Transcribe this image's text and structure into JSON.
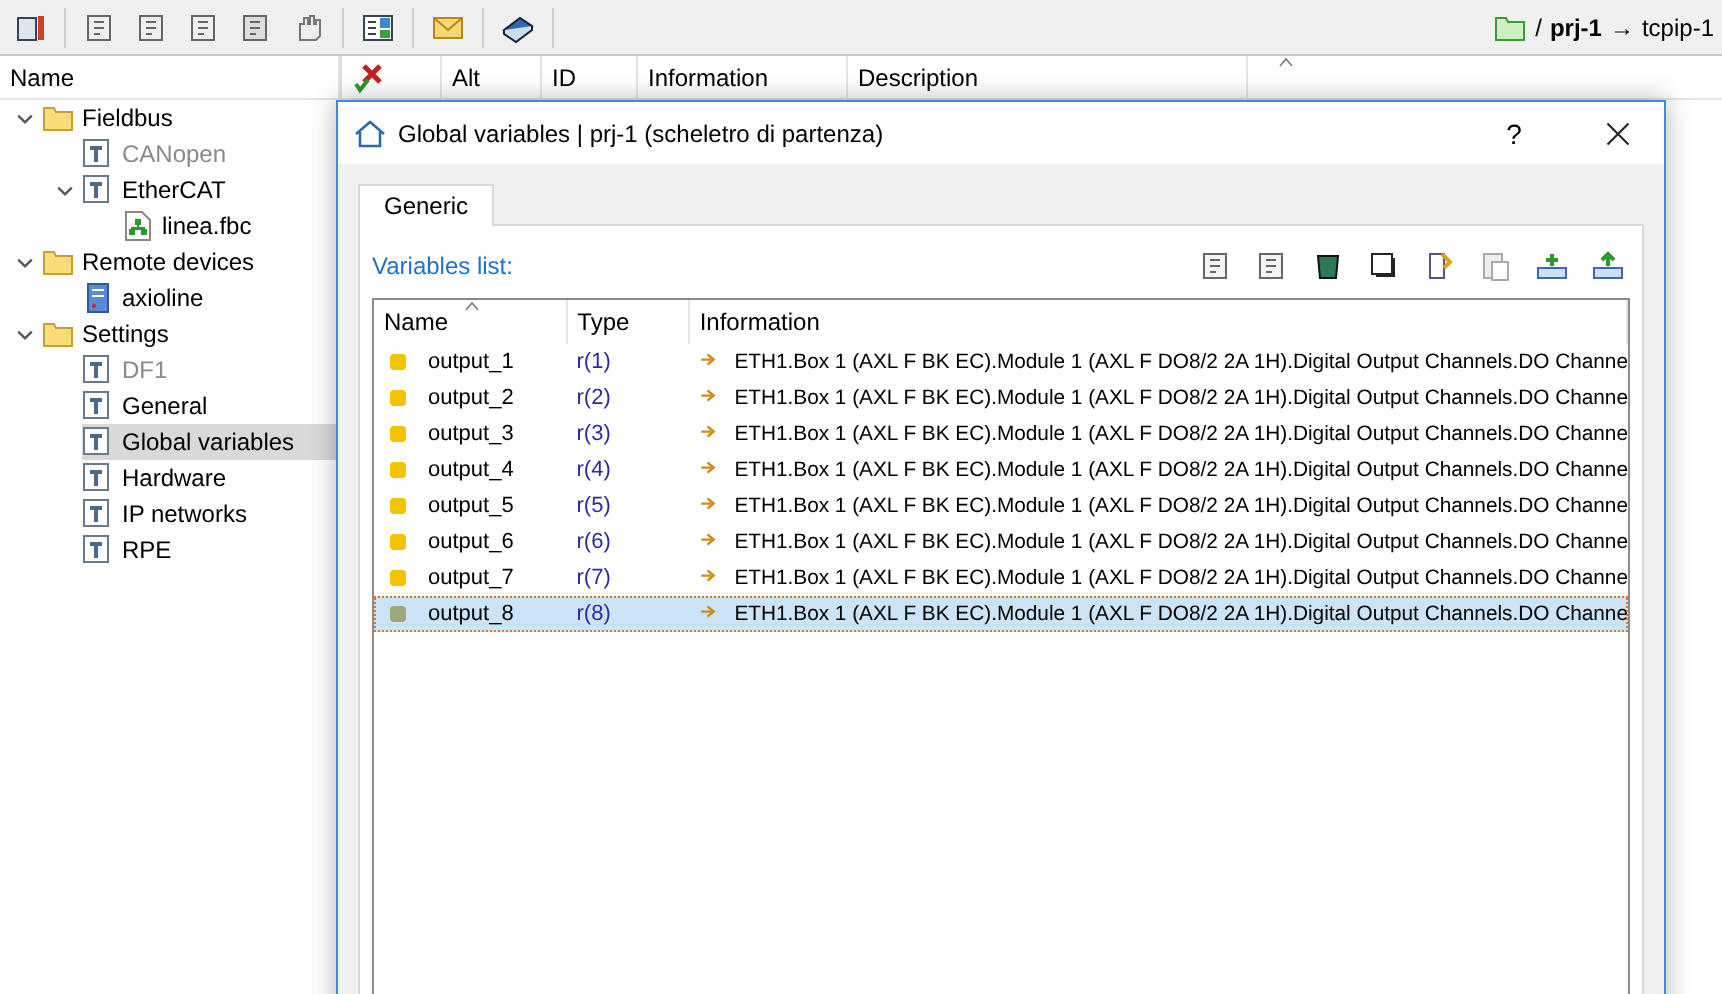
{
  "toolbar": {
    "breadcrumb": {
      "separator": "/",
      "project": "prj-1",
      "arrow": "→",
      "target": "tcpip-1"
    }
  },
  "tree": {
    "header": "Name",
    "items": [
      {
        "label": "Fieldbus",
        "kind": "folder",
        "expanded": true,
        "selected": false,
        "children": [
          {
            "label": "CANopen",
            "kind": "config",
            "disabled": true,
            "selected": false
          },
          {
            "label": "EtherCAT",
            "kind": "config",
            "disabled": false,
            "expanded": true,
            "selected": false,
            "children": [
              {
                "label": "linea.fbc",
                "kind": "network",
                "selected": false
              }
            ]
          }
        ]
      },
      {
        "label": "Remote devices",
        "kind": "folder",
        "expanded": true,
        "selected": false,
        "children": [
          {
            "label": "axioline",
            "kind": "device",
            "selected": false
          }
        ]
      },
      {
        "label": "Settings",
        "kind": "folder",
        "expanded": true,
        "selected": false,
        "children": [
          {
            "label": "DF1",
            "kind": "config",
            "disabled": true,
            "selected": false
          },
          {
            "label": "General",
            "kind": "config",
            "disabled": false,
            "selected": false
          },
          {
            "label": "Global variables",
            "kind": "config",
            "disabled": false,
            "selected": true
          },
          {
            "label": "Hardware",
            "kind": "config",
            "disabled": false,
            "selected": false
          },
          {
            "label": "IP networks",
            "kind": "config",
            "disabled": false,
            "selected": false
          },
          {
            "label": "RPE",
            "kind": "config",
            "disabled": false,
            "selected": false
          }
        ]
      }
    ]
  },
  "list_view": {
    "columns": [
      "Alt",
      "ID",
      "Information",
      "Description"
    ]
  },
  "dialog": {
    "title": "Global variables | prj-1 (scheletro di partenza)",
    "help": "?",
    "tabs": [
      {
        "label": "Generic",
        "selected": true
      }
    ],
    "section_label": "Variables list:",
    "table": {
      "columns": [
        "Name",
        "Type",
        "Information"
      ],
      "rows": [
        {
          "name": "output_1",
          "type": "r(1)",
          "information": "ETH1.Box 1 (AXL F BK EC).Module 1 (AXL F DO8/2 2A 1H).Digital Output Channels.DO Channe",
          "color": "#f5c400",
          "selected": false
        },
        {
          "name": "output_2",
          "type": "r(2)",
          "information": "ETH1.Box 1 (AXL F BK EC).Module 1 (AXL F DO8/2 2A 1H).Digital Output Channels.DO Channe",
          "color": "#f5c400",
          "selected": false
        },
        {
          "name": "output_3",
          "type": "r(3)",
          "information": "ETH1.Box 1 (AXL F BK EC).Module 1 (AXL F DO8/2 2A 1H).Digital Output Channels.DO Channe",
          "color": "#f5c400",
          "selected": false
        },
        {
          "name": "output_4",
          "type": "r(4)",
          "information": "ETH1.Box 1 (AXL F BK EC).Module 1 (AXL F DO8/2 2A 1H).Digital Output Channels.DO Channe",
          "color": "#f5c400",
          "selected": false
        },
        {
          "name": "output_5",
          "type": "r(5)",
          "information": "ETH1.Box 1 (AXL F BK EC).Module 1 (AXL F DO8/2 2A 1H).Digital Output Channels.DO Channe",
          "color": "#f5c400",
          "selected": false
        },
        {
          "name": "output_6",
          "type": "r(6)",
          "information": "ETH1.Box 1 (AXL F BK EC).Module 1 (AXL F DO8/2 2A 1H).Digital Output Channels.DO Channe",
          "color": "#f5c400",
          "selected": false
        },
        {
          "name": "output_7",
          "type": "r(7)",
          "information": "ETH1.Box 1 (AXL F BK EC).Module 1 (AXL F DO8/2 2A 1H).Digital Output Channels.DO Channe",
          "color": "#f5c400",
          "selected": false
        },
        {
          "name": "output_8",
          "type": "r(8)",
          "information": "ETH1.Box 1 (AXL F BK EC).Module 1 (AXL F DO8/2 2A 1H).Digital Output Channels.DO Channe",
          "color": "#9aa87a",
          "selected": true
        }
      ]
    }
  }
}
